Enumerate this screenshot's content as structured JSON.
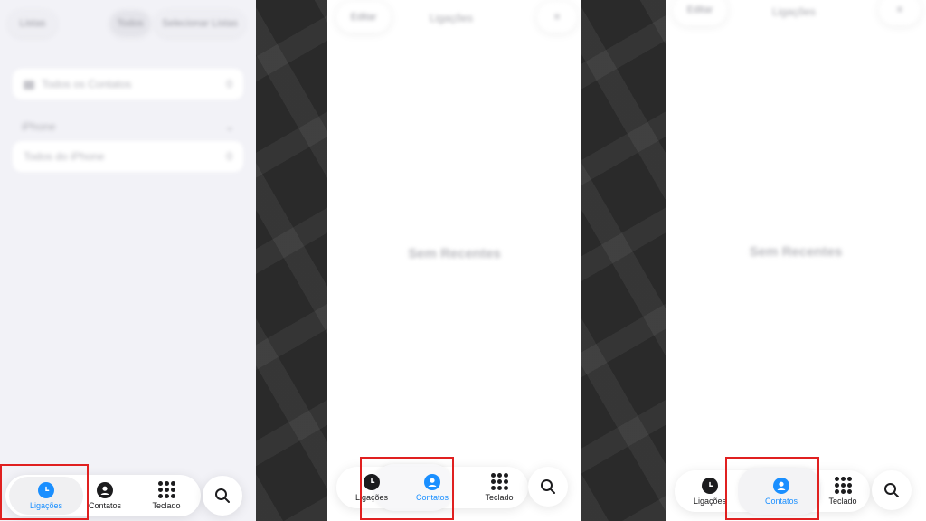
{
  "panel1": {
    "left_button": "Listas",
    "toggle_label": "Todos",
    "right_button": "Selecionar Listas",
    "row_all_contacts": "Todos os Contatos",
    "row_all_contacts_count": "0",
    "section_title": "iPhone",
    "row_all_iphone": "Todos do iPhone",
    "row_all_iphone_count": "0"
  },
  "panel2": {
    "left_button": "Editar",
    "title": "Ligações",
    "empty_text": "Sem Recentes"
  },
  "panel3": {
    "left_button": "Editar",
    "title": "Ligações",
    "empty_text": "Sem Recentes"
  },
  "tabs": {
    "calls": "Ligações",
    "contacts": "Contatos",
    "keypad": "Teclado",
    "calls_overlapped": "Ligações",
    "contacts_overlapped": "Contatos"
  },
  "icons": {
    "calls": "clock-icon",
    "contacts": "person-circle-icon",
    "keypad": "keypad-grid-icon",
    "search": "search-icon"
  },
  "colors": {
    "accent": "#1a8fff",
    "highlight_box": "#e02020",
    "background_light": "#f2f2f7"
  }
}
